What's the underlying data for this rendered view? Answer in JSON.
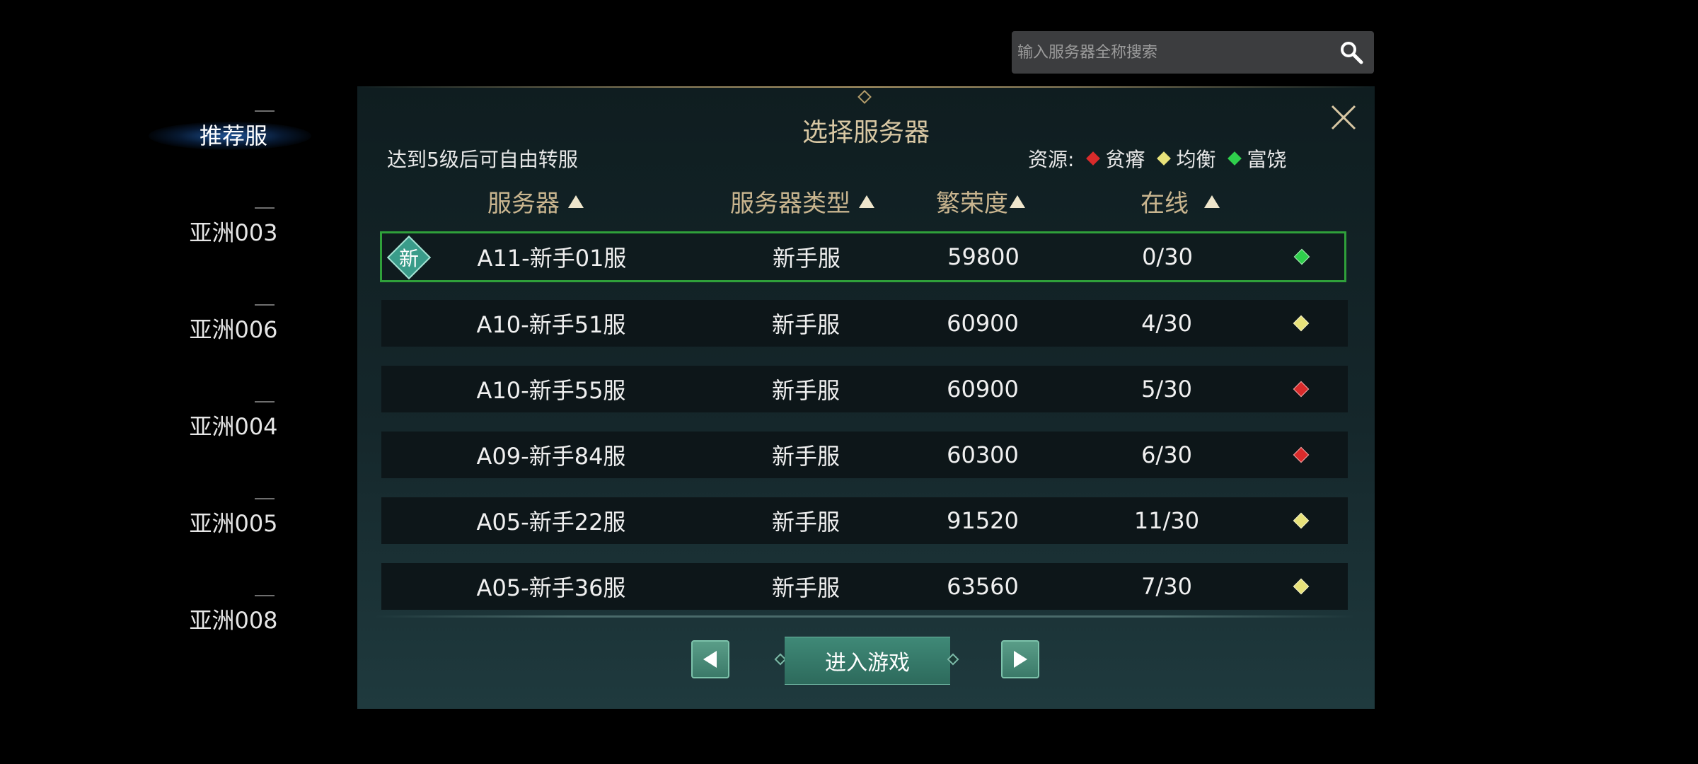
{
  "colors": {
    "resource_poor": "#d92b2b",
    "resource_balanced": "#e8e27a",
    "resource_rich": "#2fcf4c",
    "accent_title": "#d8c7a3",
    "selected_border": "#2fa03a"
  },
  "search": {
    "placeholder": "输入服务器全称搜索",
    "icon": "search-icon"
  },
  "sidebar": {
    "items": [
      {
        "label": "推荐服",
        "active": true
      },
      {
        "label": "亚洲003",
        "active": false
      },
      {
        "label": "亚洲006",
        "active": false
      },
      {
        "label": "亚洲004",
        "active": false
      },
      {
        "label": "亚洲005",
        "active": false
      },
      {
        "label": "亚洲008",
        "active": false
      }
    ]
  },
  "panel": {
    "title": "选择服务器",
    "hint": "达到5级后可自由转服",
    "legend": {
      "label": "资源:",
      "items": [
        {
          "name": "贫瘠",
          "color": "#d92b2b"
        },
        {
          "name": "均衡",
          "color": "#e8e27a"
        },
        {
          "name": "富饶",
          "color": "#2fcf4c"
        }
      ]
    },
    "columns": {
      "server": "服务器",
      "type": "服务器类型",
      "prosperity": "繁荣度",
      "online": "在线"
    },
    "new_badge": "新",
    "rows": [
      {
        "name": "A11-新手01服",
        "type": "新手服",
        "prosperity": "59800",
        "online": "0/30",
        "resource": "rich",
        "is_new": true,
        "selected": true
      },
      {
        "name": "A10-新手51服",
        "type": "新手服",
        "prosperity": "60900",
        "online": "4/30",
        "resource": "balanced",
        "is_new": false,
        "selected": false
      },
      {
        "name": "A10-新手55服",
        "type": "新手服",
        "prosperity": "60900",
        "online": "5/30",
        "resource": "poor",
        "is_new": false,
        "selected": false
      },
      {
        "name": "A09-新手84服",
        "type": "新手服",
        "prosperity": "60300",
        "online": "6/30",
        "resource": "poor",
        "is_new": false,
        "selected": false
      },
      {
        "name": "A05-新手22服",
        "type": "新手服",
        "prosperity": "91520",
        "online": "11/30",
        "resource": "balanced",
        "is_new": false,
        "selected": false
      },
      {
        "name": "A05-新手36服",
        "type": "新手服",
        "prosperity": "63560",
        "online": "7/30",
        "resource": "balanced",
        "is_new": false,
        "selected": false
      }
    ],
    "enter_button": "进入游戏"
  }
}
